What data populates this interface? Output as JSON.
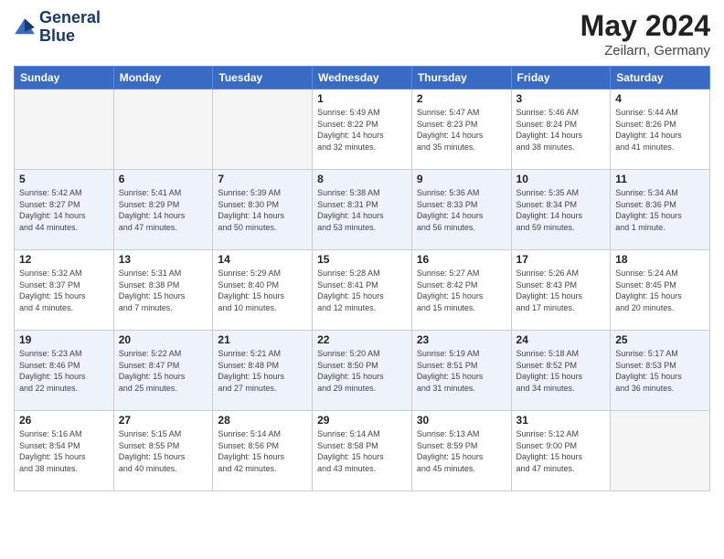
{
  "header": {
    "logo_line1": "General",
    "logo_line2": "Blue",
    "month_year": "May 2024",
    "location": "Zeilarn, Germany"
  },
  "days_of_week": [
    "Sunday",
    "Monday",
    "Tuesday",
    "Wednesday",
    "Thursday",
    "Friday",
    "Saturday"
  ],
  "weeks": [
    [
      {
        "day": "",
        "info": ""
      },
      {
        "day": "",
        "info": ""
      },
      {
        "day": "",
        "info": ""
      },
      {
        "day": "1",
        "info": "Sunrise: 5:49 AM\nSunset: 8:22 PM\nDaylight: 14 hours\nand 32 minutes."
      },
      {
        "day": "2",
        "info": "Sunrise: 5:47 AM\nSunset: 8:23 PM\nDaylight: 14 hours\nand 35 minutes."
      },
      {
        "day": "3",
        "info": "Sunrise: 5:46 AM\nSunset: 8:24 PM\nDaylight: 14 hours\nand 38 minutes."
      },
      {
        "day": "4",
        "info": "Sunrise: 5:44 AM\nSunset: 8:26 PM\nDaylight: 14 hours\nand 41 minutes."
      }
    ],
    [
      {
        "day": "5",
        "info": "Sunrise: 5:42 AM\nSunset: 8:27 PM\nDaylight: 14 hours\nand 44 minutes."
      },
      {
        "day": "6",
        "info": "Sunrise: 5:41 AM\nSunset: 8:29 PM\nDaylight: 14 hours\nand 47 minutes."
      },
      {
        "day": "7",
        "info": "Sunrise: 5:39 AM\nSunset: 8:30 PM\nDaylight: 14 hours\nand 50 minutes."
      },
      {
        "day": "8",
        "info": "Sunrise: 5:38 AM\nSunset: 8:31 PM\nDaylight: 14 hours\nand 53 minutes."
      },
      {
        "day": "9",
        "info": "Sunrise: 5:36 AM\nSunset: 8:33 PM\nDaylight: 14 hours\nand 56 minutes."
      },
      {
        "day": "10",
        "info": "Sunrise: 5:35 AM\nSunset: 8:34 PM\nDaylight: 14 hours\nand 59 minutes."
      },
      {
        "day": "11",
        "info": "Sunrise: 5:34 AM\nSunset: 8:36 PM\nDaylight: 15 hours\nand 1 minute."
      }
    ],
    [
      {
        "day": "12",
        "info": "Sunrise: 5:32 AM\nSunset: 8:37 PM\nDaylight: 15 hours\nand 4 minutes."
      },
      {
        "day": "13",
        "info": "Sunrise: 5:31 AM\nSunset: 8:38 PM\nDaylight: 15 hours\nand 7 minutes."
      },
      {
        "day": "14",
        "info": "Sunrise: 5:29 AM\nSunset: 8:40 PM\nDaylight: 15 hours\nand 10 minutes."
      },
      {
        "day": "15",
        "info": "Sunrise: 5:28 AM\nSunset: 8:41 PM\nDaylight: 15 hours\nand 12 minutes."
      },
      {
        "day": "16",
        "info": "Sunrise: 5:27 AM\nSunset: 8:42 PM\nDaylight: 15 hours\nand 15 minutes."
      },
      {
        "day": "17",
        "info": "Sunrise: 5:26 AM\nSunset: 8:43 PM\nDaylight: 15 hours\nand 17 minutes."
      },
      {
        "day": "18",
        "info": "Sunrise: 5:24 AM\nSunset: 8:45 PM\nDaylight: 15 hours\nand 20 minutes."
      }
    ],
    [
      {
        "day": "19",
        "info": "Sunrise: 5:23 AM\nSunset: 8:46 PM\nDaylight: 15 hours\nand 22 minutes."
      },
      {
        "day": "20",
        "info": "Sunrise: 5:22 AM\nSunset: 8:47 PM\nDaylight: 15 hours\nand 25 minutes."
      },
      {
        "day": "21",
        "info": "Sunrise: 5:21 AM\nSunset: 8:48 PM\nDaylight: 15 hours\nand 27 minutes."
      },
      {
        "day": "22",
        "info": "Sunrise: 5:20 AM\nSunset: 8:50 PM\nDaylight: 15 hours\nand 29 minutes."
      },
      {
        "day": "23",
        "info": "Sunrise: 5:19 AM\nSunset: 8:51 PM\nDaylight: 15 hours\nand 31 minutes."
      },
      {
        "day": "24",
        "info": "Sunrise: 5:18 AM\nSunset: 8:52 PM\nDaylight: 15 hours\nand 34 minutes."
      },
      {
        "day": "25",
        "info": "Sunrise: 5:17 AM\nSunset: 8:53 PM\nDaylight: 15 hours\nand 36 minutes."
      }
    ],
    [
      {
        "day": "26",
        "info": "Sunrise: 5:16 AM\nSunset: 8:54 PM\nDaylight: 15 hours\nand 38 minutes."
      },
      {
        "day": "27",
        "info": "Sunrise: 5:15 AM\nSunset: 8:55 PM\nDaylight: 15 hours\nand 40 minutes."
      },
      {
        "day": "28",
        "info": "Sunrise: 5:14 AM\nSunset: 8:56 PM\nDaylight: 15 hours\nand 42 minutes."
      },
      {
        "day": "29",
        "info": "Sunrise: 5:14 AM\nSunset: 8:58 PM\nDaylight: 15 hours\nand 43 minutes."
      },
      {
        "day": "30",
        "info": "Sunrise: 5:13 AM\nSunset: 8:59 PM\nDaylight: 15 hours\nand 45 minutes."
      },
      {
        "day": "31",
        "info": "Sunrise: 5:12 AM\nSunset: 9:00 PM\nDaylight: 15 hours\nand 47 minutes."
      },
      {
        "day": "",
        "info": ""
      }
    ]
  ]
}
